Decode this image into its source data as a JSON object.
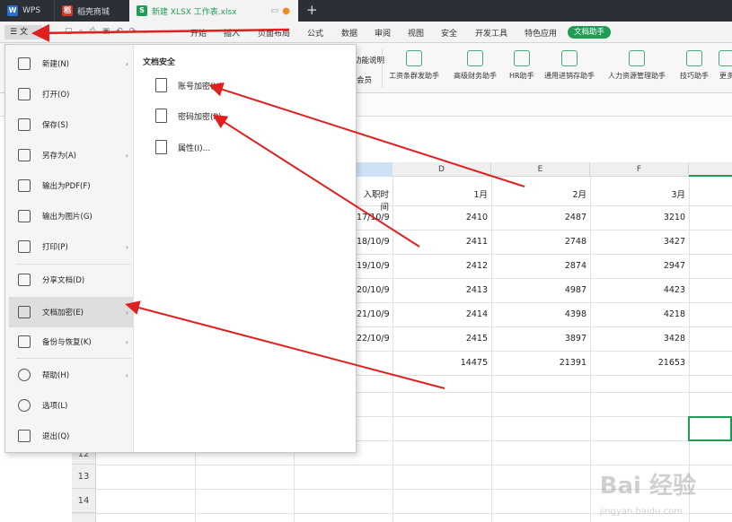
{
  "titlebar": {
    "tabs": [
      {
        "label": "WPS",
        "color": "#2b6fd6"
      },
      {
        "label": "稻壳商城",
        "color": "#d9362b"
      },
      {
        "label": "新建 XLSX 工作表.xlsx",
        "color": "#1f9d55"
      }
    ],
    "new_tab": "+"
  },
  "menubar": {
    "file_btn": "文",
    "items": [
      "开始",
      "插入",
      "页面布局",
      "公式",
      "数据",
      "审阅",
      "视图",
      "安全",
      "开发工具",
      "特色应用"
    ],
    "active": "文档助手"
  },
  "ribbon": {
    "partial_top": "功能说明",
    "partial_bottom": "会员",
    "buttons": [
      "工资条群发助手",
      "高级财务助手",
      "HR助手",
      "通用进销存助手",
      "人力资源管理助手",
      "技巧助手",
      "更多"
    ]
  },
  "columns": [
    "D",
    "E",
    "F"
  ],
  "rows": [
    "12",
    "13",
    "14"
  ],
  "table": {
    "header": [
      "入职时间",
      "1月",
      "2月",
      "3月"
    ],
    "dates": [
      "17/10/9",
      "18/10/9",
      "19/10/9",
      "20/10/9",
      "21/10/9",
      "22/10/9"
    ],
    "col_d": [
      "2410",
      "2411",
      "2412",
      "2413",
      "2414",
      "2415",
      "14475"
    ],
    "col_e": [
      "2487",
      "2748",
      "2874",
      "4987",
      "4398",
      "3897",
      "21391"
    ],
    "col_f": [
      "3210",
      "3427",
      "2947",
      "4423",
      "4218",
      "3428",
      "21653"
    ]
  },
  "file_menu": {
    "items": [
      {
        "label": "新建(N)",
        "icon": "new-file-icon",
        "arrow": true
      },
      {
        "label": "打开(O)",
        "icon": "folder-icon",
        "arrow": false
      },
      {
        "label": "保存(S)",
        "icon": "save-icon",
        "arrow": false
      },
      {
        "label": "另存为(A)",
        "icon": "save-as-icon",
        "arrow": true
      },
      {
        "label": "输出为PDF(F)",
        "icon": "pdf-icon",
        "arrow": false
      },
      {
        "label": "输出为图片(G)",
        "icon": "image-icon",
        "arrow": false
      },
      {
        "label": "打印(P)",
        "icon": "printer-icon",
        "arrow": true
      },
      {
        "label": "分享文档(D)",
        "icon": "share-icon",
        "arrow": false
      },
      {
        "label": "文档加密(E)",
        "icon": "encrypt-icon",
        "arrow": true
      },
      {
        "label": "备份与恢复(K)",
        "icon": "backup-icon",
        "arrow": true
      },
      {
        "label": "帮助(H)",
        "icon": "help-icon",
        "arrow": true
      },
      {
        "label": "选项(L)",
        "icon": "gear-icon",
        "arrow": false
      },
      {
        "label": "退出(Q)",
        "icon": "exit-icon",
        "arrow": false
      }
    ],
    "section_title": "文档安全",
    "sub_items": [
      "账号加密(U)",
      "密码加密(P)",
      "属性(I)..."
    ]
  },
  "watermark": {
    "logo": "Bai 经验",
    "url": "jingyan.baidu.com"
  },
  "colors": {
    "accent": "#1f9d55",
    "annotation": "#e02020",
    "titlebar": "#2b2f36"
  }
}
